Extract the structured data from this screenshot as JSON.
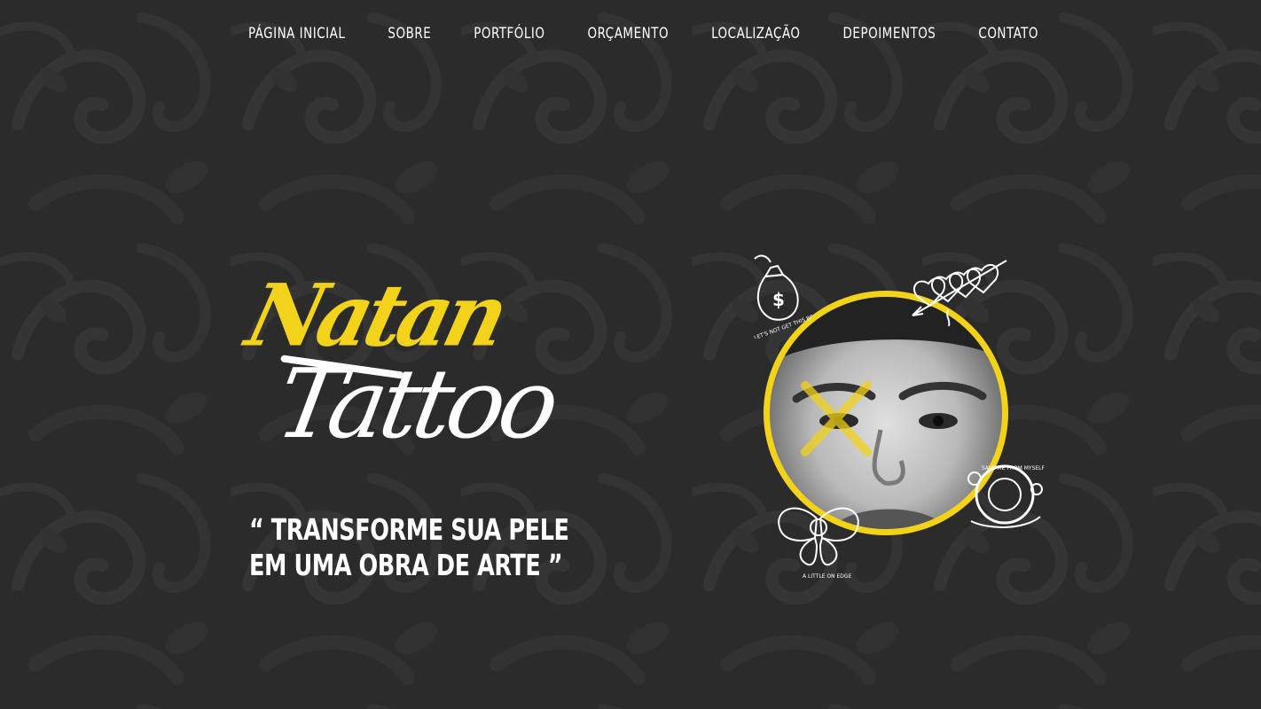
{
  "nav": {
    "items": [
      {
        "label": "PÁGINA INICIAL"
      },
      {
        "label": "SOBRE"
      },
      {
        "label": "PORTFÓLIO"
      },
      {
        "label": "ORÇAMENTO"
      },
      {
        "label": "LOCALIZAÇÃO"
      },
      {
        "label": "DEPOIMENTOS"
      },
      {
        "label": "CONTATO"
      }
    ]
  },
  "logo": {
    "line1": "Natan",
    "line2": "Tattoo"
  },
  "quote": {
    "line1": "“ TRANSFORME SUA PELE",
    "line2": "EM UMA OBRA DE ARTE ”"
  },
  "flash_texts": {
    "money_bag": "LET'S NOT GET THIS BREAD",
    "buoy": "SAVE ME FROM MYSELF",
    "butterfly": "A LITTLE ON EDGE"
  },
  "colors": {
    "accent": "#f2d21a",
    "background": "#2b2b2b",
    "text": "#ffffff"
  },
  "icons": [
    "money-bag-icon",
    "pierced-hearts-icon",
    "life-buoy-icon",
    "butterfly-icon"
  ]
}
